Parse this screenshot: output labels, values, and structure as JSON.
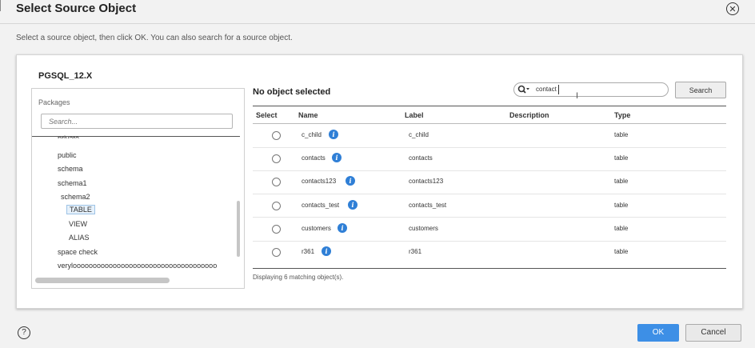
{
  "dialog": {
    "title": "Select Source Object",
    "instructions": "Select a source object, then click OK. You can also search for a source object."
  },
  "connection": "PGSQL_12.X",
  "tree": {
    "label": "Packages",
    "search_placeholder": "Search...",
    "nodes": [
      {
        "label": "private",
        "depth": 1
      },
      {
        "label": "public",
        "depth": 1
      },
      {
        "label": "schema",
        "depth": 1
      },
      {
        "label": "schema1",
        "depth": 1
      },
      {
        "label": "schema2",
        "depth": 1
      },
      {
        "label": "TABLE",
        "depth": 2,
        "selected": true
      },
      {
        "label": "VIEW",
        "depth": 2
      },
      {
        "label": "ALIAS",
        "depth": 2
      },
      {
        "label": "space check",
        "depth": 1
      },
      {
        "label": "veryloooooooooooooooooooooooooooooooooooo",
        "depth": 1
      }
    ]
  },
  "selection_status": "No object selected",
  "search": {
    "value": "contact",
    "button": "Search"
  },
  "table": {
    "columns": [
      "Select",
      "Name",
      "Label",
      "Description",
      "Type"
    ],
    "rows": [
      {
        "name": "c_child",
        "label": "c_child",
        "description": "",
        "type": "table"
      },
      {
        "name": "contacts",
        "label": "contacts",
        "description": "",
        "type": "table"
      },
      {
        "name": "contacts123",
        "label": "contacts123",
        "description": "",
        "type": "table"
      },
      {
        "name": "contacts_test",
        "label": "contacts_test",
        "description": "",
        "type": "table"
      },
      {
        "name": "customers",
        "label": "customers",
        "description": "",
        "type": "table"
      },
      {
        "name": "r361",
        "label": "r361",
        "description": "",
        "type": "table"
      }
    ],
    "footer": "Displaying 6 matching object(s)."
  },
  "buttons": {
    "ok": "OK",
    "cancel": "Cancel"
  },
  "icons": {
    "close": "close-icon",
    "help": "help-icon",
    "info": "info-icon",
    "search": "search-icon"
  },
  "colors": {
    "accent": "#3d8fe6",
    "info": "#2f7fd6"
  }
}
